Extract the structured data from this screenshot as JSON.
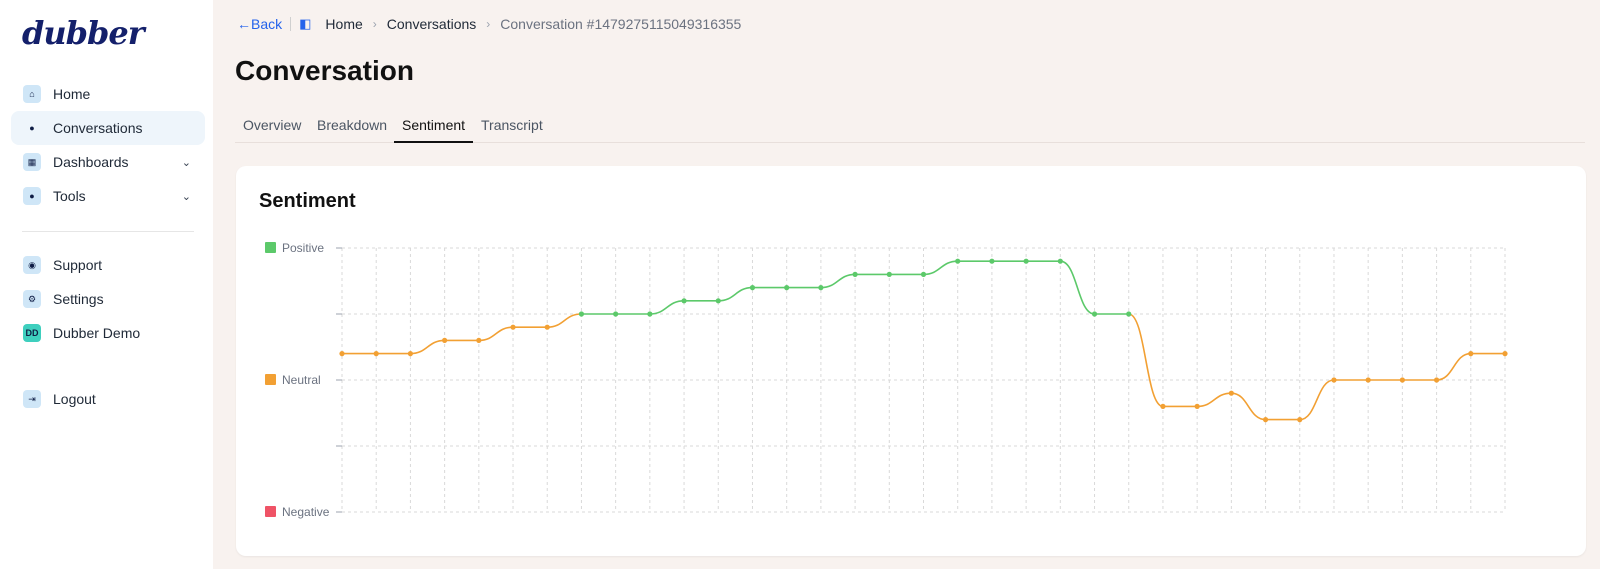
{
  "sidebar": {
    "logo": "dubber",
    "items": [
      {
        "label": "Home",
        "icon": "home-icon"
      },
      {
        "label": "Conversations",
        "icon": "chat-bubble-icon"
      },
      {
        "label": "Dashboards",
        "icon": "grid-icon"
      },
      {
        "label": "Tools",
        "icon": "tools-icon"
      },
      {
        "label": "Support",
        "icon": "support-icon"
      },
      {
        "label": "Settings",
        "icon": "gear-icon"
      },
      {
        "label": "Dubber Demo",
        "avatar": "DD"
      },
      {
        "label": "Logout",
        "icon": "logout-icon"
      }
    ]
  },
  "breadcrumb": {
    "back": "Back",
    "items": [
      "Home",
      "Conversations",
      "Conversation #1479275115049316355"
    ]
  },
  "page": {
    "title": "Conversation"
  },
  "tabs": [
    "Overview",
    "Breakdown",
    "Sentiment",
    "Transcript"
  ],
  "active_tab": "Sentiment",
  "card": {
    "title": "Sentiment"
  },
  "colors": {
    "positive": "#5cc96a",
    "neutral": "#f2a033",
    "negative": "#ef5366",
    "accent": "#2563eb"
  },
  "chart_data": {
    "type": "line",
    "title": "Sentiment",
    "legend": [
      "Positive",
      "Neutral",
      "Negative"
    ],
    "ylim": [
      -1,
      1
    ],
    "x": [
      1,
      2,
      3,
      4,
      5,
      6,
      7,
      8,
      9,
      10,
      11,
      12,
      13,
      14,
      15,
      16,
      17,
      18,
      19,
      20,
      21,
      22,
      23,
      24,
      25,
      26,
      27,
      28,
      29,
      30,
      31,
      32,
      33,
      34,
      35
    ],
    "values": [
      0.2,
      0.2,
      0.2,
      0.3,
      0.3,
      0.4,
      0.4,
      0.5,
      0.5,
      0.5,
      0.6,
      0.6,
      0.7,
      0.7,
      0.7,
      0.8,
      0.8,
      0.8,
      0.9,
      0.9,
      0.9,
      0.9,
      0.5,
      0.5,
      -0.2,
      -0.2,
      -0.1,
      -0.3,
      -0.3,
      0.0,
      0.0,
      0.0,
      0.0,
      0.2,
      0.2
    ]
  }
}
